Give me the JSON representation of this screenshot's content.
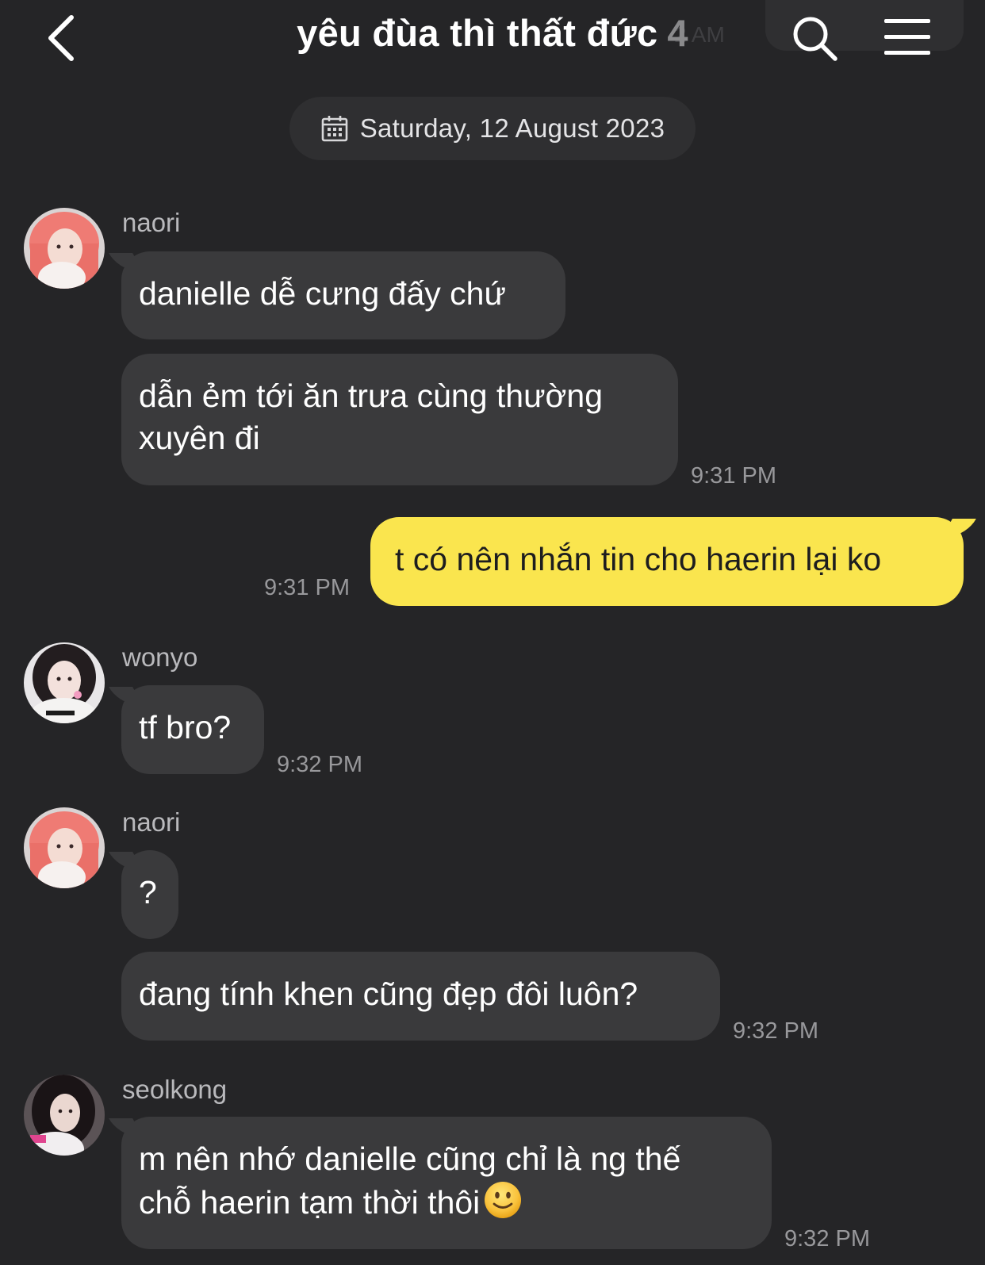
{
  "header": {
    "title": "yêu đùa thì thất đức",
    "member_count": "4",
    "background_time": "2 AM"
  },
  "date_divider": {
    "label": "Saturday, 12 August 2023"
  },
  "messages": [
    {
      "sender": "naori",
      "bubbles": [
        "danielle dễ cưng đấy chứ",
        "dẫn ẻm tới ăn trưa cùng thường",
        "xuyên đi"
      ],
      "time": "9:31 PM"
    },
    {
      "mine": true,
      "text": "t có nên nhắn tin cho haerin lại ko",
      "time": "9:31 PM"
    },
    {
      "sender": "wonyo",
      "bubbles": [
        "tf bro?"
      ],
      "time": "9:32 PM"
    },
    {
      "sender": "naori",
      "bubbles": [
        "?",
        "đang tính khen cũng đẹp đôi luôn?"
      ],
      "time": "9:32 PM"
    },
    {
      "sender": "seolkong",
      "bubbles": [
        "m nên nhớ danielle cũng chỉ là ng thế",
        "chỗ haerin tạm thời thôi"
      ],
      "time": "9:32 PM",
      "emoji": "slightly-smiling-face"
    }
  ],
  "colors": {
    "background": "#252527",
    "bubble_other": "#3a3a3c",
    "bubble_mine": "#fae54e",
    "timestamp": "#98989b"
  },
  "icons": [
    "back-arrow-icon",
    "search-icon",
    "menu-icon",
    "calendar-icon"
  ]
}
